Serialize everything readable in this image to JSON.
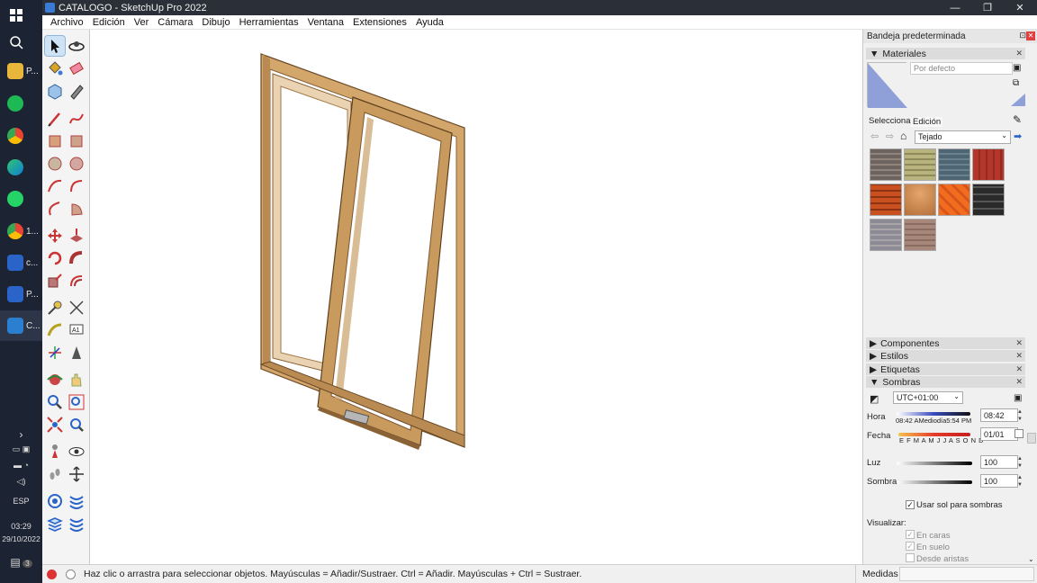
{
  "taskbar": {
    "apps": [
      {
        "name": "start-icon",
        "label": ""
      },
      {
        "name": "search-icon",
        "label": ""
      },
      {
        "name": "folder-app",
        "label": "P..."
      },
      {
        "name": "spotify-app",
        "label": ""
      },
      {
        "name": "chrome-app",
        "label": ""
      },
      {
        "name": "edge-app",
        "label": ""
      },
      {
        "name": "whatsapp-app",
        "label": ""
      },
      {
        "name": "chrome-window-app",
        "label": "1..."
      },
      {
        "name": "app-c1",
        "label": "c..."
      },
      {
        "name": "app-p",
        "label": "P..."
      },
      {
        "name": "sketchup-app",
        "label": "C..."
      }
    ],
    "language": "ESP",
    "time": "03:29",
    "date": "29/10/2022",
    "notifications": "3"
  },
  "window": {
    "title": "CATALOGO - SketchUp Pro 2022"
  },
  "menu": [
    "Archivo",
    "Edición",
    "Ver",
    "Cámara",
    "Dibujo",
    "Herramientas",
    "Ventana",
    "Extensiones",
    "Ayuda"
  ],
  "tray": {
    "title": "Bandeja predeterminada",
    "materials": {
      "title": "Materiales",
      "current": "Por defecto",
      "tab_select": "Seleccionar",
      "tab_edit": "Edición",
      "library": "Tejado"
    },
    "panels": {
      "components": "Componentes",
      "styles": "Estilos",
      "tags": "Etiquetas",
      "shadows": "Sombras"
    },
    "shadows": {
      "timezone": "UTC+01:00",
      "time_label": "Hora",
      "time_value": "08:42",
      "time_ticks": "08:42 AMediodía5:54 PM",
      "date_label": "Fecha",
      "date_value": "01/01",
      "months": "E F M A M J J A S O N D",
      "light_label": "Luz",
      "light_value": "100",
      "shade_label": "Sombra",
      "shade_value": "100",
      "use_sun": "Usar sol para sombras",
      "display_label": "Visualizar:",
      "on_faces": "En caras",
      "on_ground": "En suelo",
      "from_edges": "Desde aristas"
    }
  },
  "status": {
    "message": "Haz clic o arrastra para seleccionar objetos. Mayúsculas = Añadir/Sustraer. Ctrl = Añadir. Mayúsculas + Ctrl = Sustraer.",
    "measures_label": "Medidas"
  },
  "colors": {
    "accent": "#3a7bd5",
    "wood": "#c89a5e",
    "wood_dark": "#8a6236"
  }
}
